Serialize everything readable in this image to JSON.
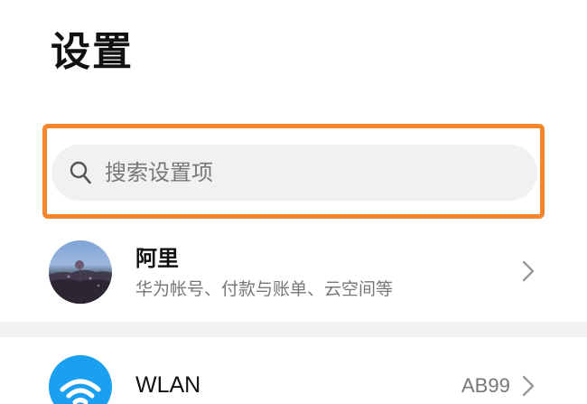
{
  "header": {
    "title": "设置"
  },
  "search": {
    "placeholder": "搜索设置项",
    "icon": "search-icon"
  },
  "account": {
    "name": "阿里",
    "subtitle": "华为帐号、付款与账单、云空间等",
    "chevron_icon": "chevron-right-icon"
  },
  "settings": {
    "items": [
      {
        "label": "WLAN",
        "value": "AB99",
        "icon": "wifi-icon",
        "icon_color": "#1a9ff1"
      }
    ]
  },
  "colors": {
    "highlight_border": "#f5862b",
    "search_background": "#f1f1f3",
    "secondary_text": "#777777"
  }
}
